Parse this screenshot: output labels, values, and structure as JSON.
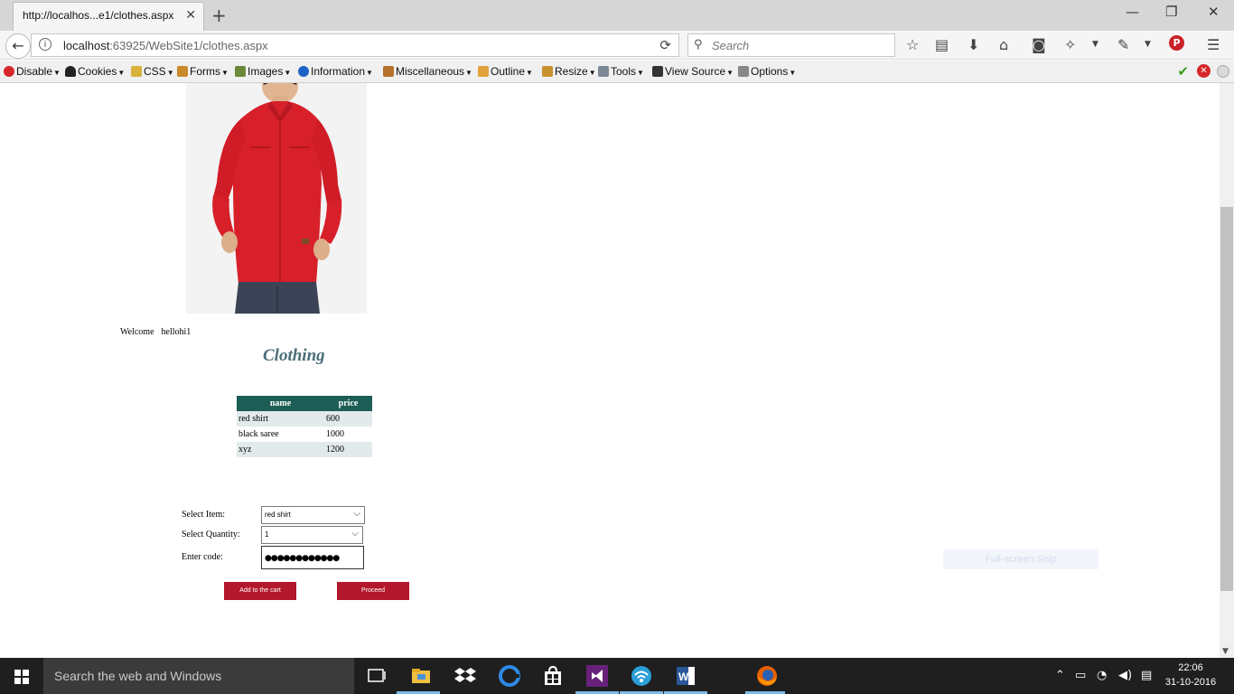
{
  "browser": {
    "tab_title": "http://localhos...e1/clothes.aspx",
    "url_host": "localhost",
    "url_path": ":63925/WebSite1/clothes.aspx",
    "search_placeholder": "Search"
  },
  "dev_toolbar": {
    "items": [
      "Disable",
      "Cookies",
      "CSS",
      "Forms",
      "Images",
      "Information",
      "Miscellaneous",
      "Outline",
      "Resize",
      "Tools",
      "View Source",
      "Options"
    ]
  },
  "page": {
    "welcome_label": "Welcome",
    "username": "hellohi1",
    "heading": "Clothing",
    "table": {
      "columns": [
        "name",
        "price"
      ],
      "rows": [
        [
          "red shirt",
          "600"
        ],
        [
          "black saree",
          "1000"
        ],
        [
          "xyz",
          "1200"
        ]
      ]
    },
    "form": {
      "select_item_label": "Select Item:",
      "select_item_value": "red shirt",
      "select_quantity_label": "Select Quantity:",
      "select_quantity_value": "1",
      "code_label": "Enter code:",
      "code_value": "●●●●●●●●●●●●"
    },
    "buttons": {
      "add_to_cart": "Add to the cart",
      "proceed": "Proceed"
    },
    "overlay_text": "Full-screen Snip"
  },
  "taskbar": {
    "search_text": "Search the web and Windows",
    "time": "22:06",
    "date": "31-10-2016"
  }
}
